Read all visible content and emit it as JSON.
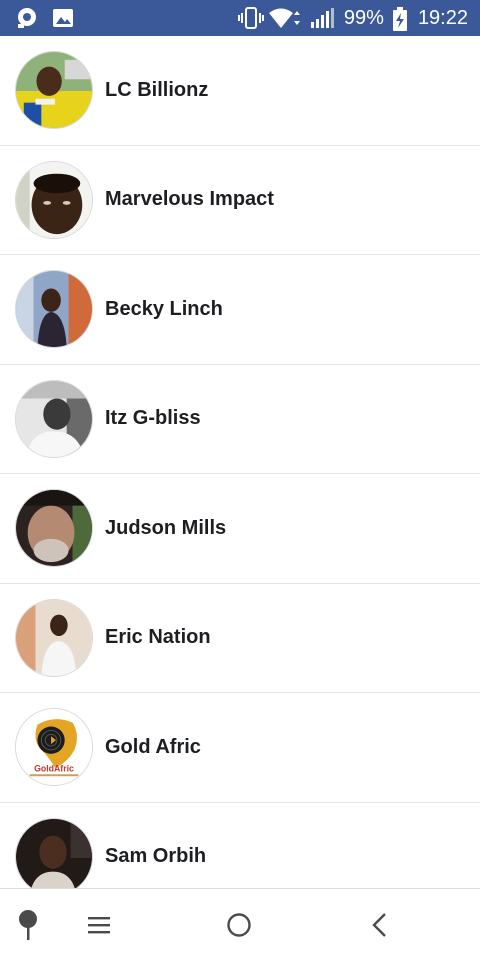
{
  "status_bar": {
    "battery": "99%",
    "time": "19:22",
    "icons": [
      "notification-app-icon",
      "image-icon",
      "vibrate-icon",
      "wifi-icon",
      "signal-icon",
      "battery-charging-icon"
    ],
    "background": "#3b5998"
  },
  "friends": [
    {
      "name": "LC Billionz",
      "avatar": "avatar-photo"
    },
    {
      "name": "Marvelous Impact",
      "avatar": "avatar-photo"
    },
    {
      "name": "Becky Linch",
      "avatar": "avatar-photo"
    },
    {
      "name": "Itz G-bliss",
      "avatar": "avatar-photo-grayscale"
    },
    {
      "name": "Judson Mills",
      "avatar": "avatar-photo"
    },
    {
      "name": "Eric Nation",
      "avatar": "avatar-photo"
    },
    {
      "name": "Gold Afric",
      "avatar": "gold-afric-logo"
    },
    {
      "name": "Sam Orbih",
      "avatar": "avatar-photo"
    }
  ],
  "gold_afric_logo_text": "GoldAfric",
  "navbar": {
    "buttons": [
      "pin-icon",
      "menu-icon",
      "home-icon",
      "back-icon"
    ]
  }
}
